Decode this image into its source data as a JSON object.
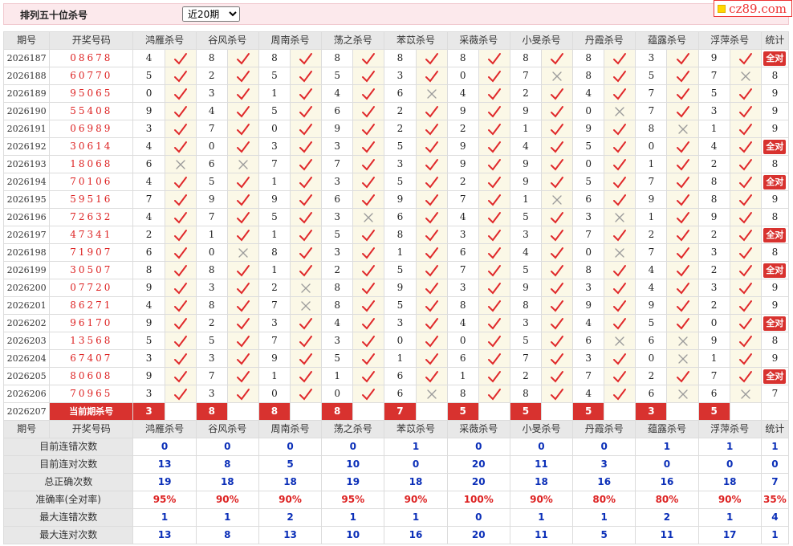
{
  "header": {
    "title": "排列五十位杀号",
    "select_value": "近20期",
    "select_options": [
      "近20期"
    ],
    "logo_text": "cz89.com"
  },
  "columns": {
    "period": "期号",
    "draw": "开奖号码",
    "stat": "统计",
    "experts": [
      "鸿雁杀号",
      "谷风杀号",
      "周南杀号",
      "荡之杀号",
      "苯苡杀号",
      "采薇杀号",
      "小旻杀号",
      "丹霞杀号",
      "蕴露杀号",
      "浮萍杀号"
    ]
  },
  "all_right_label": "全对",
  "rows": [
    {
      "period": "2026187",
      "draw": "08678",
      "kills": [
        4,
        8,
        8,
        8,
        8,
        8,
        8,
        8,
        3,
        9
      ],
      "results": [
        1,
        1,
        1,
        1,
        1,
        1,
        1,
        1,
        1,
        1
      ],
      "stat": "全对"
    },
    {
      "period": "2026188",
      "draw": "60770",
      "kills": [
        5,
        2,
        5,
        5,
        3,
        0,
        7,
        8,
        5,
        7
      ],
      "results": [
        1,
        1,
        1,
        1,
        1,
        1,
        0,
        1,
        1,
        0
      ],
      "stat": "8"
    },
    {
      "period": "2026189",
      "draw": "95065",
      "kills": [
        0,
        3,
        1,
        4,
        6,
        4,
        2,
        4,
        7,
        5
      ],
      "results": [
        1,
        1,
        1,
        1,
        0,
        1,
        1,
        1,
        1,
        1
      ],
      "stat": "9"
    },
    {
      "period": "2026190",
      "draw": "55408",
      "kills": [
        9,
        4,
        5,
        6,
        2,
        9,
        9,
        0,
        7,
        3
      ],
      "results": [
        1,
        1,
        1,
        1,
        1,
        1,
        1,
        0,
        1,
        1
      ],
      "stat": "9"
    },
    {
      "period": "2026191",
      "draw": "06989",
      "kills": [
        3,
        7,
        0,
        9,
        2,
        2,
        1,
        9,
        8,
        1
      ],
      "results": [
        1,
        1,
        1,
        1,
        1,
        1,
        1,
        1,
        0,
        1
      ],
      "stat": "9"
    },
    {
      "period": "2026192",
      "draw": "30614",
      "kills": [
        4,
        0,
        3,
        3,
        5,
        9,
        4,
        5,
        0,
        4
      ],
      "results": [
        1,
        1,
        1,
        1,
        1,
        1,
        1,
        1,
        1,
        1
      ],
      "stat": "全对"
    },
    {
      "period": "2026193",
      "draw": "18068",
      "kills": [
        6,
        6,
        7,
        7,
        3,
        9,
        9,
        0,
        1,
        2
      ],
      "results": [
        0,
        0,
        1,
        1,
        1,
        1,
        1,
        1,
        1,
        1
      ],
      "stat": "8"
    },
    {
      "period": "2026194",
      "draw": "70106",
      "kills": [
        4,
        5,
        1,
        3,
        5,
        2,
        9,
        5,
        7,
        8
      ],
      "results": [
        1,
        1,
        1,
        1,
        1,
        1,
        1,
        1,
        1,
        1
      ],
      "stat": "全对"
    },
    {
      "period": "2026195",
      "draw": "59516",
      "kills": [
        7,
        9,
        9,
        6,
        9,
        7,
        1,
        6,
        9,
        8
      ],
      "results": [
        1,
        1,
        1,
        1,
        1,
        1,
        0,
        1,
        1,
        1
      ],
      "stat": "9"
    },
    {
      "period": "2026196",
      "draw": "72632",
      "kills": [
        4,
        7,
        5,
        3,
        6,
        4,
        5,
        3,
        1,
        9
      ],
      "results": [
        1,
        1,
        1,
        0,
        1,
        1,
        1,
        0,
        1,
        1
      ],
      "stat": "8"
    },
    {
      "period": "2026197",
      "draw": "47341",
      "kills": [
        2,
        1,
        1,
        5,
        8,
        3,
        3,
        7,
        2,
        2
      ],
      "results": [
        1,
        1,
        1,
        1,
        1,
        1,
        1,
        1,
        1,
        1
      ],
      "stat": "全对"
    },
    {
      "period": "2026198",
      "draw": "71907",
      "kills": [
        6,
        0,
        8,
        3,
        1,
        6,
        4,
        0,
        7,
        3
      ],
      "results": [
        1,
        0,
        1,
        1,
        1,
        1,
        1,
        0,
        1,
        1
      ],
      "stat": "8"
    },
    {
      "period": "2026199",
      "draw": "30507",
      "kills": [
        8,
        8,
        1,
        2,
        5,
        7,
        5,
        8,
        4,
        2
      ],
      "results": [
        1,
        1,
        1,
        1,
        1,
        1,
        1,
        1,
        1,
        1
      ],
      "stat": "全对"
    },
    {
      "period": "2026200",
      "draw": "07720",
      "kills": [
        9,
        3,
        2,
        8,
        9,
        3,
        9,
        3,
        4,
        3
      ],
      "results": [
        1,
        1,
        0,
        1,
        1,
        1,
        1,
        1,
        1,
        1
      ],
      "stat": "9"
    },
    {
      "period": "2026201",
      "draw": "86271",
      "kills": [
        4,
        8,
        7,
        8,
        5,
        8,
        8,
        9,
        9,
        2
      ],
      "results": [
        1,
        1,
        0,
        1,
        1,
        1,
        1,
        1,
        1,
        1
      ],
      "stat": "9"
    },
    {
      "period": "2026202",
      "draw": "96170",
      "kills": [
        9,
        2,
        3,
        4,
        3,
        4,
        3,
        4,
        5,
        0
      ],
      "results": [
        1,
        1,
        1,
        1,
        1,
        1,
        1,
        1,
        1,
        1
      ],
      "stat": "全对"
    },
    {
      "period": "2026203",
      "draw": "13568",
      "kills": [
        5,
        5,
        7,
        3,
        0,
        0,
        5,
        6,
        6,
        9
      ],
      "results": [
        1,
        1,
        1,
        1,
        1,
        1,
        1,
        0,
        0,
        1
      ],
      "stat": "8"
    },
    {
      "period": "2026204",
      "draw": "67407",
      "kills": [
        3,
        3,
        9,
        5,
        1,
        6,
        7,
        3,
        0,
        1
      ],
      "results": [
        1,
        1,
        1,
        1,
        1,
        1,
        1,
        1,
        0,
        1
      ],
      "stat": "9"
    },
    {
      "period": "2026205",
      "draw": "80608",
      "kills": [
        9,
        7,
        1,
        1,
        6,
        1,
        2,
        7,
        2,
        7
      ],
      "results": [
        1,
        1,
        1,
        1,
        1,
        1,
        1,
        1,
        1,
        1
      ],
      "stat": "全对"
    },
    {
      "period": "2026206",
      "draw": "70965",
      "kills": [
        3,
        3,
        0,
        0,
        6,
        8,
        8,
        4,
        6,
        6
      ],
      "results": [
        1,
        1,
        1,
        1,
        0,
        1,
        1,
        1,
        0,
        0
      ],
      "stat": "7"
    }
  ],
  "current": {
    "period": "2026207",
    "label": "当前期杀号",
    "kills": [
      3,
      8,
      8,
      8,
      7,
      5,
      5,
      5,
      3,
      5
    ]
  },
  "summary_rows": [
    {
      "label": "目前连错次数",
      "values": [
        "0",
        "0",
        "0",
        "0",
        "1",
        "0",
        "0",
        "0",
        "1",
        "1",
        "1"
      ]
    },
    {
      "label": "目前连对次数",
      "values": [
        "13",
        "8",
        "5",
        "10",
        "0",
        "20",
        "11",
        "3",
        "0",
        "0",
        "0"
      ]
    },
    {
      "label": "总正确次数",
      "values": [
        "19",
        "18",
        "18",
        "19",
        "18",
        "20",
        "18",
        "16",
        "16",
        "18",
        "7"
      ]
    },
    {
      "label": "准确率(全对率)",
      "values": [
        "95%",
        "90%",
        "90%",
        "95%",
        "90%",
        "100%",
        "90%",
        "80%",
        "80%",
        "90%",
        "35%"
      ],
      "red": true
    },
    {
      "label": "最大连错次数",
      "values": [
        "1",
        "1",
        "2",
        "1",
        "1",
        "0",
        "1",
        "1",
        "2",
        "1",
        "4"
      ]
    },
    {
      "label": "最大连对次数",
      "values": [
        "13",
        "8",
        "13",
        "10",
        "16",
        "20",
        "11",
        "5",
        "11",
        "17",
        "1"
      ]
    }
  ],
  "colors": {
    "accent_red": "#d8322f",
    "check_red": "#e0282a",
    "cross_gray": "#9a9a9a",
    "header_bg": "#e8e8e8",
    "result_bg": "#fbf8e7",
    "summary_blue": "#0b2fb8",
    "title_bar_bg": "#fce9ec"
  },
  "icons": {
    "correct": "check-icon",
    "wrong": "cross-icon"
  }
}
